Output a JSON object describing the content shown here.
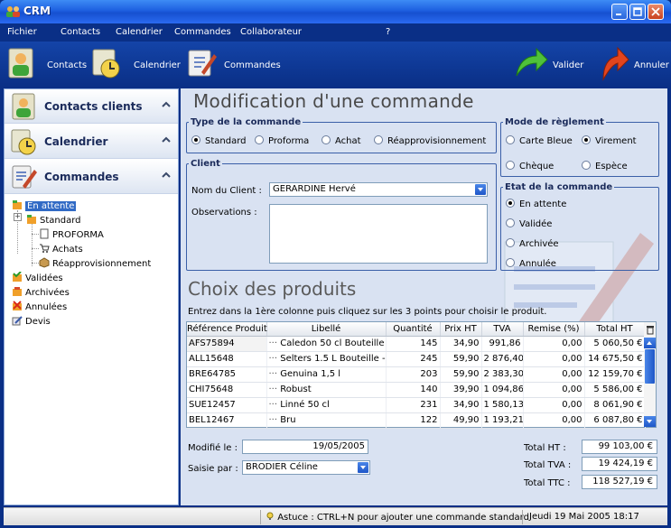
{
  "window": {
    "title": "CRM"
  },
  "menu": [
    "Fichier",
    "Contacts",
    "Calendrier",
    "Commandes",
    "Collaborateur",
    "?"
  ],
  "toolbar": {
    "contacts": "Contacts",
    "calendrier": "Calendrier",
    "commandes": "Commandes",
    "valider": "Valider",
    "annuler": "Annuler"
  },
  "sidebar": {
    "sections": [
      "Contacts clients",
      "Calendrier",
      "Commandes"
    ],
    "tree": {
      "en_attente": "En attente",
      "standard": "Standard",
      "proforma": "PROFORMA",
      "achats": "Achats",
      "reappro": "Réapprovisionnement",
      "validees": "Validées",
      "archivees": "Archivées",
      "annulees": "Annulées",
      "devis": "Devis"
    }
  },
  "form": {
    "title": "Modification d'une commande",
    "type_group": "Type de la commande",
    "type_options": [
      "Standard",
      "Proforma",
      "Achat",
      "Réapprovisionnement"
    ],
    "type_selected": "Standard",
    "mode_group": "Mode de règlement",
    "mode_options": [
      "Carte Bleue",
      "Virement",
      "Chèque",
      "Espèce"
    ],
    "mode_selected": "Virement",
    "client_group": "Client",
    "client_label": "Nom du Client :",
    "client_value": "GERARDINE Hervé",
    "obs_label": "Observations :",
    "etat_group": "Etat de la commande",
    "etat_options": [
      "En attente",
      "Validée",
      "Archivée",
      "Annulée"
    ],
    "etat_selected": "En attente"
  },
  "products": {
    "title": "Choix des produits",
    "instruction": "Entrez dans la 1ère colonne puis cliquez sur les 3 points pour choisir le produit.",
    "columns": [
      "Référence Produit",
      "Libellé",
      "Quantité",
      "Prix HT",
      "TVA",
      "Remise (%)",
      "Total HT"
    ],
    "rows": [
      [
        "AFS75894",
        "Caledon 50 cl Bouteille -",
        "145",
        "34,90",
        "991,86",
        "0,00",
        "5 060,50 €"
      ],
      [
        "ALL15648",
        "Selters 1.5 L Bouteille -",
        "245",
        "59,90",
        "2 876,40",
        "0,00",
        "14 675,50 €"
      ],
      [
        "BRE64785",
        "Genuina 1,5 l",
        "203",
        "59,90",
        "2 383,30",
        "0,00",
        "12 159,70 €"
      ],
      [
        "CHI75648",
        "Robust",
        "140",
        "39,90",
        "1 094,86",
        "0,00",
        "5 586,00 €"
      ],
      [
        "SUE12457",
        "Linné 50 cl",
        "231",
        "34,90",
        "1 580,13",
        "0,00",
        "8 061,90 €"
      ],
      [
        "BEL12467",
        "Bru",
        "122",
        "49,90",
        "1 193,21",
        "0,00",
        "6 087,80 €"
      ]
    ]
  },
  "footer": {
    "modified_label": "Modifié le :",
    "modified_value": "19/05/2005",
    "saisie_label": "Saisie par :",
    "saisie_value": "BRODIER Céline",
    "total_ht_label": "Total HT :",
    "total_ht": "99 103,00 €",
    "total_tva_label": "Total TVA :",
    "total_tva": "19 424,19 €",
    "total_ttc_label": "Total TTC :",
    "total_ttc": "118 527,19 €"
  },
  "status": {
    "tip": "Astuce : CTRL+N pour ajouter une commande standard",
    "datetime": "Jeudi 19 Mai 2005 18:17"
  },
  "colors": {
    "accent": "#0a2f86",
    "selection": "#316ac5",
    "panel": "#d9e2f2"
  }
}
